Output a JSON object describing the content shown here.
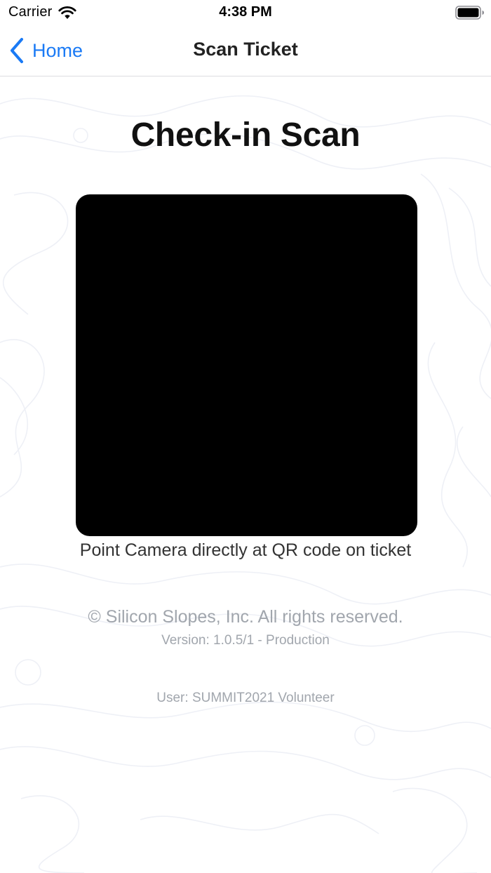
{
  "status_bar": {
    "carrier": "Carrier",
    "time": "4:38 PM",
    "wifi_icon": "wifi-icon",
    "battery_icon": "battery-icon"
  },
  "nav": {
    "back_label": "Home",
    "back_icon": "chevron-left-icon",
    "title": "Scan Ticket"
  },
  "main": {
    "title": "Check-in Scan",
    "instruction": "Point Camera directly at QR code on ticket"
  },
  "footer": {
    "copyright": "© Silicon Slopes, Inc. All rights reserved.",
    "version": "Version: 1.0.5/1 - Production",
    "user": "User: SUMMIT2021 Volunteer"
  },
  "colors": {
    "accent": "#1a7af5",
    "muted_text": "#a1a6ad",
    "background": "#ffffff",
    "camera_preview": "#000000"
  }
}
